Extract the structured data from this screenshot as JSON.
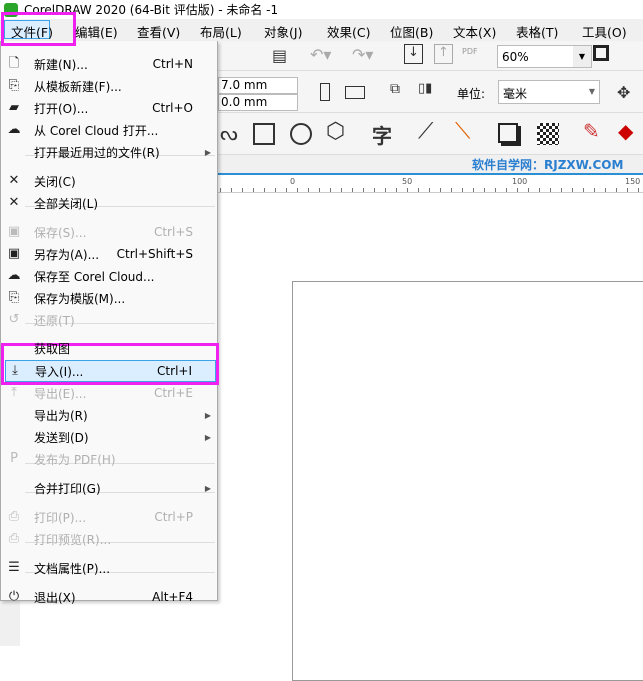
{
  "window": {
    "title": "CorelDRAW 2020 (64-Bit 评估版) - 未命名 -1"
  },
  "menubar": [
    "文件(F)",
    "编辑(E)",
    "查看(V)",
    "布局(L)",
    "对象(J)",
    "效果(C)",
    "位图(B)",
    "文本(X)",
    "表格(T)",
    "工具(O)"
  ],
  "toolbar": {
    "zoom": "60%",
    "width": "7.0 mm",
    "height": "0.0 mm",
    "unit_label": "单位:",
    "unit": "毫米",
    "pdf": "PDF",
    "text_tool": "字"
  },
  "watermark": "软件自学网：RJZXW.COM",
  "ruler": [
    "0",
    "50",
    "100",
    "150"
  ],
  "colors": {
    "highlight_box": "#f020f0",
    "menu_hover": "#dbeeff",
    "hover_border": "#3aa3e8"
  },
  "file_menu": [
    {
      "label": "新建(N)...",
      "shortcut": "Ctrl+N",
      "icon": "new-document-icon"
    },
    {
      "label": "从模板新建(F)...",
      "icon": "new-from-template-icon"
    },
    {
      "label": "打开(O)...",
      "shortcut": "Ctrl+O",
      "icon": "folder-open-icon"
    },
    {
      "label": "从 Corel Cloud 打开...",
      "icon": "cloud-download-icon"
    },
    {
      "label": "打开最近用过的文件(R)",
      "submenu": true
    },
    {
      "label": "关闭(C)",
      "icon": "close-document-icon"
    },
    {
      "label": "全部关闭(L)",
      "icon": "close-all-icon"
    },
    {
      "label": "保存(S)...",
      "shortcut": "Ctrl+S",
      "disabled": true,
      "icon": "save-icon"
    },
    {
      "label": "另存为(A)...",
      "shortcut": "Ctrl+Shift+S",
      "icon": "save-as-icon"
    },
    {
      "label": "保存至 Corel Cloud...",
      "icon": "cloud-upload-icon"
    },
    {
      "label": "保存为模版(M)...",
      "icon": "save-template-icon"
    },
    {
      "label": "还原(T)",
      "disabled": true,
      "icon": "revert-icon"
    },
    {
      "label": "获取图"
    },
    {
      "label": "导入(I)...",
      "shortcut": "Ctrl+I",
      "highlighted": true,
      "icon": "import-icon"
    },
    {
      "label": "导出(E)...",
      "shortcut": "Ctrl+E",
      "disabled": true,
      "icon": "export-icon"
    },
    {
      "label": "导出为(R)",
      "submenu": true
    },
    {
      "label": "发送到(D)",
      "submenu": true
    },
    {
      "label": "发布为 PDF(H)",
      "disabled": true,
      "icon": "pdf-icon"
    },
    {
      "label": "合并打印(G)",
      "submenu": true
    },
    {
      "label": "打印(P)...",
      "shortcut": "Ctrl+P",
      "disabled": true,
      "icon": "print-icon"
    },
    {
      "label": "打印预览(R)...",
      "disabled": true,
      "icon": "print-preview-icon"
    },
    {
      "label": "文档属性(P)...",
      "icon": "document-properties-icon"
    },
    {
      "label": "退出(X)",
      "shortcut": "Alt+F4",
      "icon": "power-icon"
    }
  ]
}
